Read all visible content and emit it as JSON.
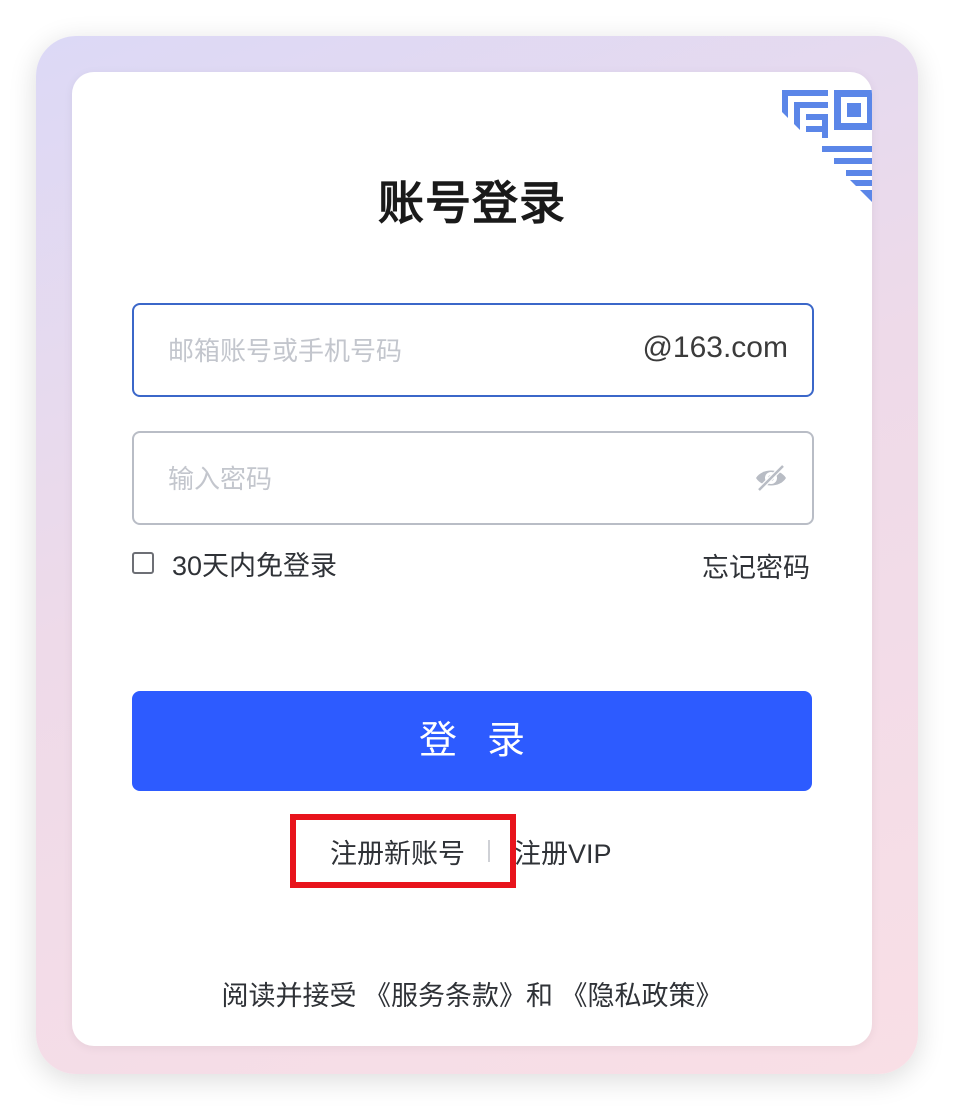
{
  "login": {
    "title": "账号登录",
    "account_placeholder": "邮箱账号或手机号码",
    "account_value": "",
    "domain_suffix": "@163.com",
    "password_placeholder": "输入密码",
    "password_value": "",
    "remember_label": "30天内免登录",
    "remember_checked": false,
    "forgot_password": "忘记密码",
    "submit_label": "登录",
    "register_new": "注册新账号",
    "register_vip": "注册VIP",
    "agreement_prefix": "阅读并接受 ",
    "terms_link": "《服务条款》",
    "agreement_and": "和 ",
    "privacy_link": "《隐私政策》"
  },
  "icons": {
    "qr_corner": "qr-code-icon",
    "password_toggle": "eye-slash-icon"
  },
  "colors": {
    "primary": "#2d5bff",
    "focus_border": "#3b67c9",
    "qr_icon": "#5b86e8",
    "highlight": "#e8141c"
  }
}
